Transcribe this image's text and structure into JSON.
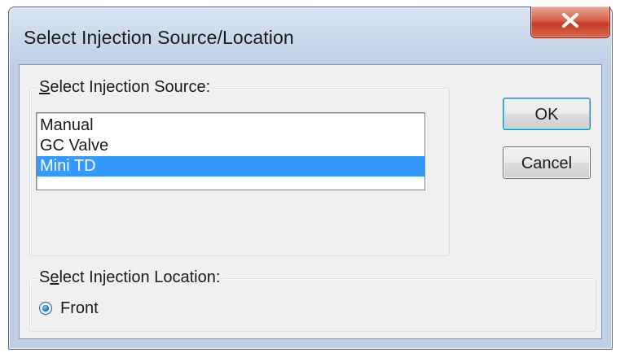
{
  "window": {
    "title": "Select Injection Source/Location",
    "close_icon": "close-x-icon",
    "close_color": "#c94a36"
  },
  "source_group": {
    "label_prefix": "",
    "label_mnemonic": "S",
    "label_rest": "elect Injection Source:",
    "items": [
      {
        "label": "Manual",
        "selected": false
      },
      {
        "label": "GC Valve",
        "selected": false
      },
      {
        "label": "Mini TD",
        "selected": true
      }
    ],
    "selection_color": "#3399ff"
  },
  "buttons": {
    "ok_label": "OK",
    "cancel_label": "Cancel"
  },
  "location_group": {
    "label_prefix": "S",
    "label_mnemonic": "e",
    "label_rest": "lect Injection Location:",
    "options": [
      {
        "label": "Front",
        "checked": true
      }
    ]
  }
}
